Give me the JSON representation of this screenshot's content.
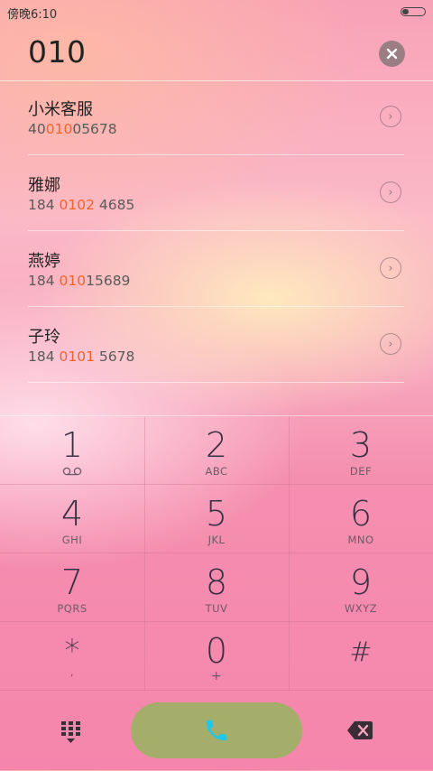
{
  "status_bar": {
    "time": "傍晚6:10",
    "battery_level": 0.3
  },
  "dialer": {
    "input_value": "010",
    "clear_icon": "close-icon"
  },
  "contacts": [
    {
      "name": "小米客服",
      "number_pre": "40",
      "number_match": "010",
      "number_post": "05678"
    },
    {
      "name": "雅娜",
      "number_pre": "184 ",
      "number_match": "0102",
      "number_post": " 4685"
    },
    {
      "name": "燕婷",
      "number_pre": "184 ",
      "number_match": "010",
      "number_post": "15689"
    },
    {
      "name": "子玲",
      "number_pre": "184 ",
      "number_match": "0101",
      "number_post": " 5678"
    }
  ],
  "keypad": [
    {
      "digit": "1",
      "sub": "",
      "sub_icon": "voicemail-icon"
    },
    {
      "digit": "2",
      "sub": "ABC"
    },
    {
      "digit": "3",
      "sub": "DEF"
    },
    {
      "digit": "4",
      "sub": "GHI"
    },
    {
      "digit": "5",
      "sub": "JKL"
    },
    {
      "digit": "6",
      "sub": "MNO"
    },
    {
      "digit": "7",
      "sub": "PQRS"
    },
    {
      "digit": "8",
      "sub": "TUV"
    },
    {
      "digit": "9",
      "sub": "WXYZ"
    },
    {
      "digit": "*",
      "sub": ","
    },
    {
      "digit": "0",
      "sub": "+"
    },
    {
      "digit": "#",
      "sub": ""
    }
  ],
  "bottom_bar": {
    "dialpad_icon": "dialpad-icon",
    "call_icon": "phone-icon",
    "backspace_icon": "backspace-icon",
    "call_button_color": "#a5ad6a",
    "call_icon_color": "#1fc8e8"
  },
  "colors": {
    "match_highlight": "#f0642c"
  }
}
